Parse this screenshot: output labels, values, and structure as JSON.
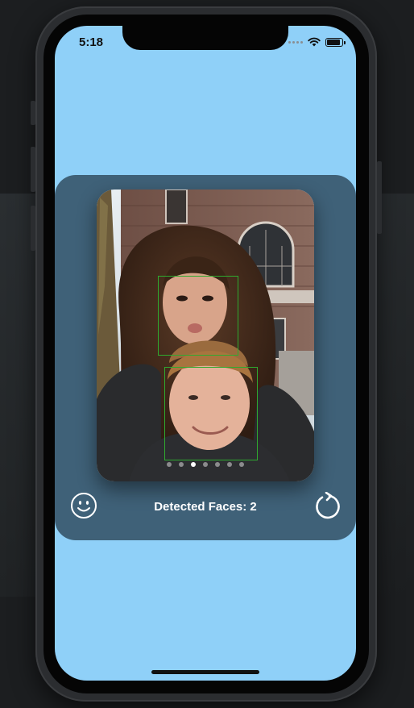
{
  "status_bar": {
    "time": "5:18"
  },
  "carousel": {
    "page_count": 7,
    "current_index": 2
  },
  "detection": {
    "label": "Detected Faces: 2"
  },
  "icons": {
    "left_button": "smiley-face-icon",
    "right_button": "rotate-reset-icon",
    "wifi": "wifi-icon",
    "battery": "battery-icon"
  },
  "colors": {
    "screen_background": "#8fd0f8",
    "card_background": "#3f6178",
    "face_box": "#2faa2f"
  }
}
